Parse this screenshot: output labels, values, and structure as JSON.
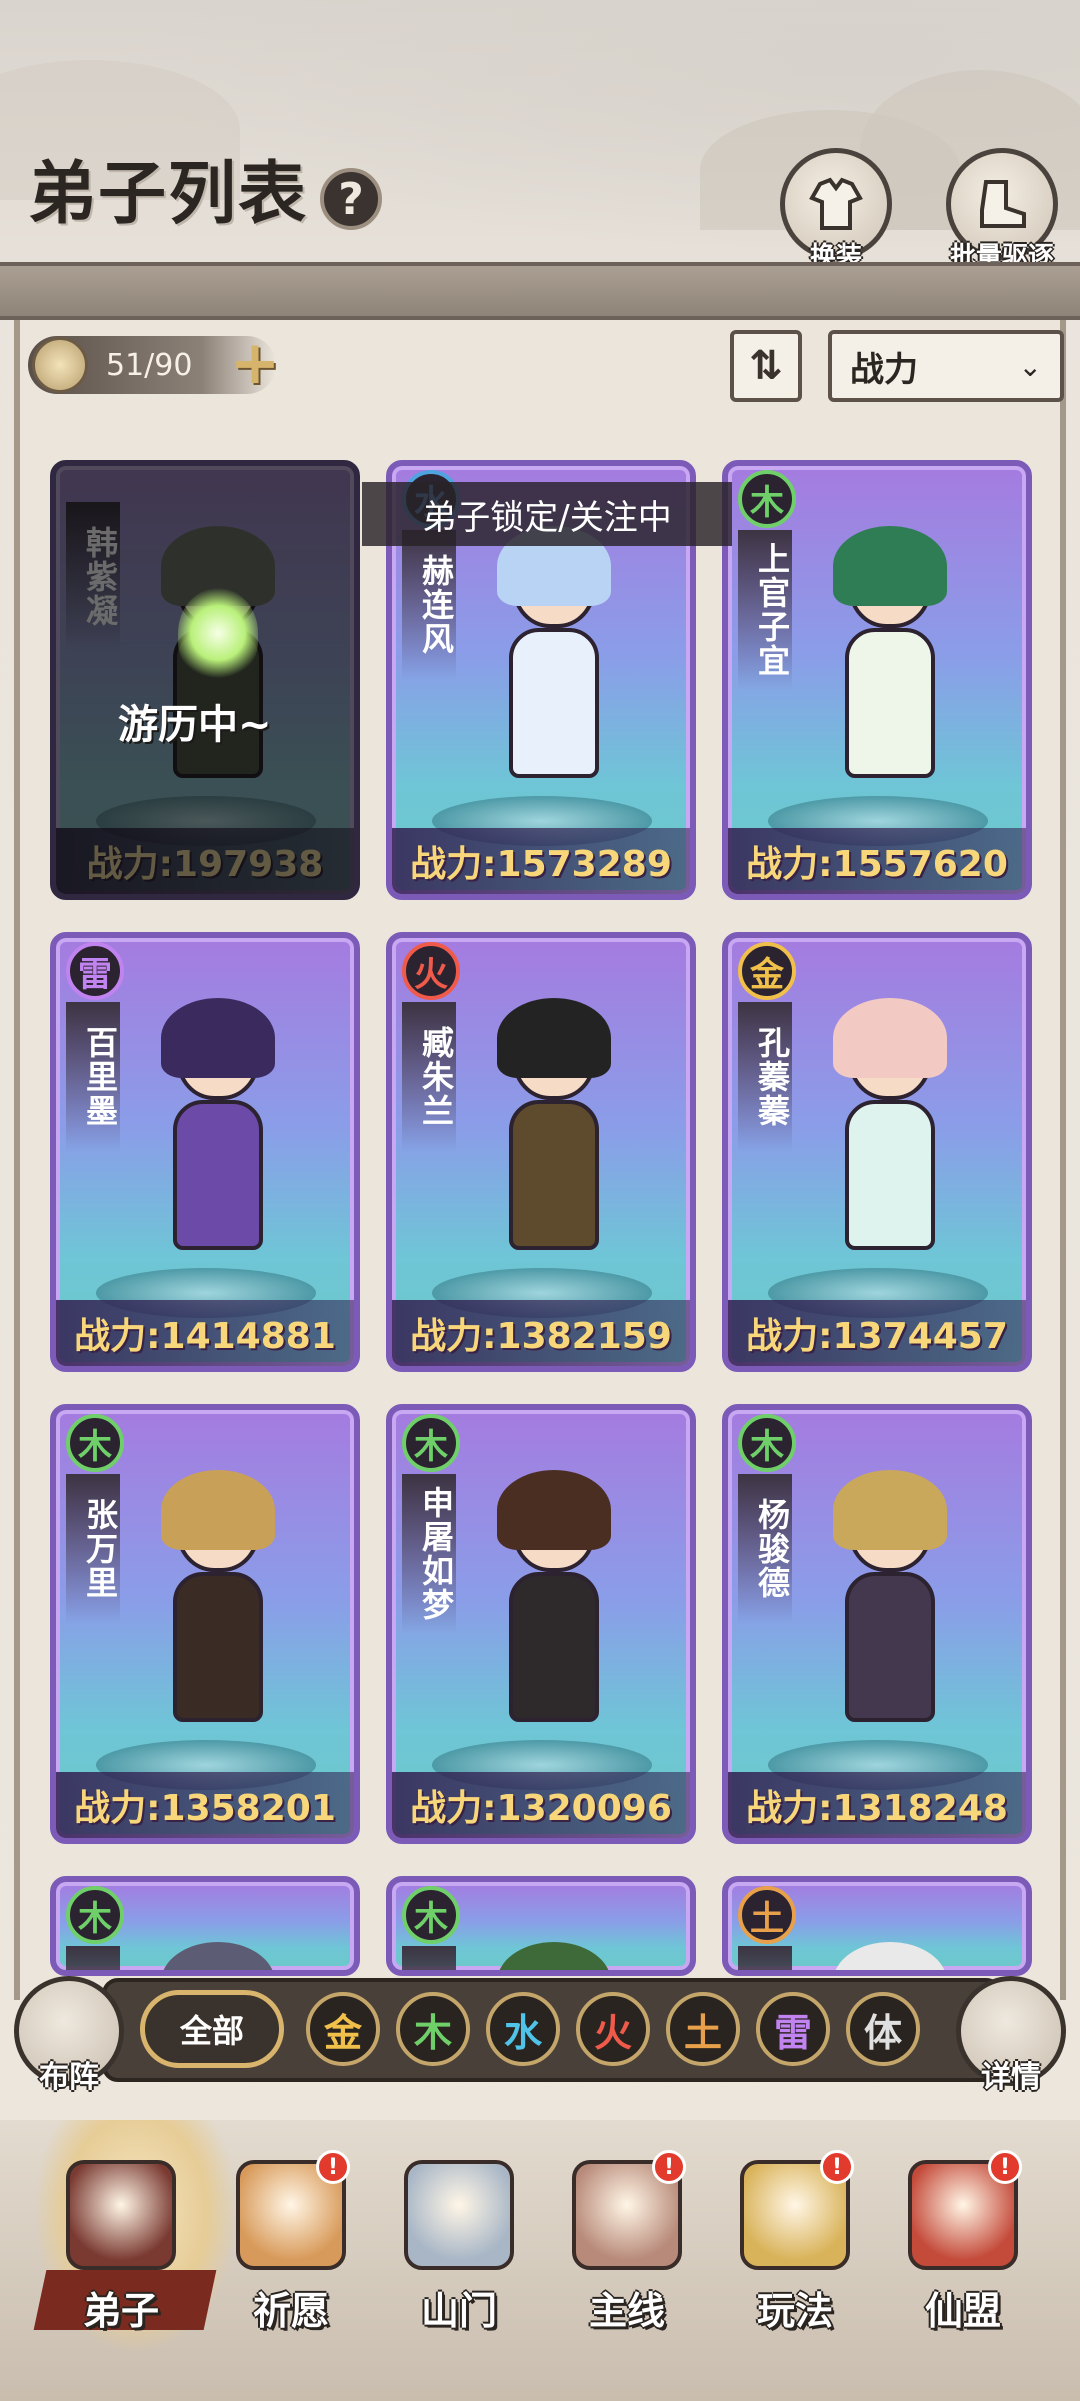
{
  "header": {
    "title": "弟子列表",
    "help_icon": "?",
    "buttons": [
      {
        "label": "换装",
        "icon": "robe-icon"
      },
      {
        "label": "批量驱逐",
        "icon": "boot-icon"
      }
    ]
  },
  "toolbar": {
    "disciple_count": "51/90",
    "add_icon": "+",
    "sort_toggle_icon": "⇅",
    "sort_value": "战力",
    "sort_chevron": "⌄"
  },
  "lock_tip": "弟子锁定/关注中",
  "traveling_text": "游历中~",
  "cards": [
    {
      "name": "韩紫凝",
      "element": "",
      "element_color": "",
      "power": "战力:197938",
      "status": "traveling",
      "hair": "#6b7560",
      "outfit": "#4a5a3e"
    },
    {
      "name": "赫连风",
      "element": "水",
      "element_color": "#4fa3e0",
      "power": "战力:1573289",
      "status": "normal",
      "hair": "#b9d3f5",
      "outfit": "#e8f0fb"
    },
    {
      "name": "上官子宜",
      "element": "木",
      "element_color": "#6fd06a",
      "power": "战力:1557620",
      "status": "normal",
      "hair": "#2f7d54",
      "outfit": "#eef6ea"
    },
    {
      "name": "百里墨",
      "element": "雷",
      "element_color": "#c083f0",
      "power": "战力:1414881",
      "status": "normal",
      "hair": "#3a2a5e",
      "outfit": "#6b4aa8"
    },
    {
      "name": "臧朱兰",
      "element": "火",
      "element_color": "#f05a4a",
      "power": "战力:1382159",
      "status": "normal",
      "hair": "#232323",
      "outfit": "#5e4a2c"
    },
    {
      "name": "孔蓁蓁",
      "element": "金",
      "element_color": "#f0c04a",
      "power": "战力:1374457",
      "status": "normal",
      "hair": "#f3c9c4",
      "outfit": "#dff3ee"
    },
    {
      "name": "张万里",
      "element": "木",
      "element_color": "#6fd06a",
      "power": "战力:1358201",
      "status": "normal",
      "hair": "#c9a058",
      "outfit": "#3a2c24"
    },
    {
      "name": "申屠如梦",
      "element": "木",
      "element_color": "#6fd06a",
      "power": "战力:1320096",
      "status": "normal",
      "hair": "#4a2e22",
      "outfit": "#2e2a2c"
    },
    {
      "name": "杨骏德",
      "element": "木",
      "element_color": "#6fd06a",
      "power": "战力:1318248",
      "status": "normal",
      "hair": "#c9a85c",
      "outfit": "#44384e"
    },
    {
      "name": "呼",
      "element": "木",
      "element_color": "#6fd06a",
      "power": "",
      "status": "partial",
      "hair": "#5c5c74",
      "outfit": "#5c5c74"
    },
    {
      "name": "叶",
      "element": "木",
      "element_color": "#6fd06a",
      "power": "",
      "status": "partial",
      "hair": "#3e6a3a",
      "outfit": "#3e6a3a"
    },
    {
      "name": "姚",
      "element": "土",
      "element_color": "#e8a04a",
      "power": "",
      "status": "partial",
      "hair": "#e9e9e9",
      "outfit": "#9a9a9a"
    }
  ],
  "filter": {
    "formation_label": "布阵",
    "all_label": "全部",
    "details_label": "详情",
    "elements": [
      {
        "label": "金",
        "color": "#f0c04a"
      },
      {
        "label": "木",
        "color": "#6fd06a"
      },
      {
        "label": "水",
        "color": "#4fc3e8"
      },
      {
        "label": "火",
        "color": "#f05a4a"
      },
      {
        "label": "土",
        "color": "#e8a04a"
      },
      {
        "label": "雷",
        "color": "#c083f0"
      },
      {
        "label": "体",
        "color": "#e0e0e0"
      }
    ]
  },
  "nav": [
    {
      "label": "弟子",
      "icon": "disciple-icon",
      "badge": "",
      "active": true
    },
    {
      "label": "祈愿",
      "icon": "wish-scroll-icon",
      "badge": "!",
      "active": false
    },
    {
      "label": "山门",
      "icon": "gate-icon",
      "badge": "",
      "active": false
    },
    {
      "label": "主线",
      "icon": "mountain-sword-icon",
      "badge": "!",
      "active": false
    },
    {
      "label": "玩法",
      "icon": "scroll-map-icon",
      "badge": "!",
      "active": false
    },
    {
      "label": "仙盟",
      "icon": "alliance-banner-icon",
      "badge": "!",
      "active": false
    }
  ]
}
